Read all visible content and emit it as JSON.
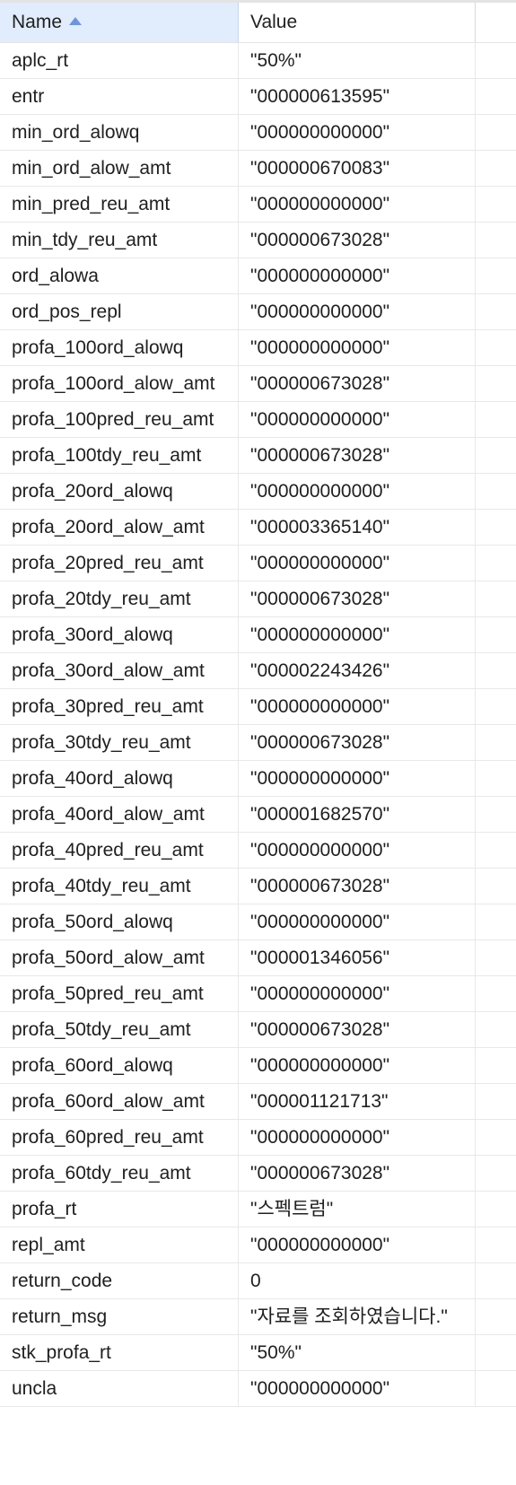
{
  "header": {
    "name_label": "Name",
    "value_label": "Value",
    "sort_icon": "sort-ascending-icon"
  },
  "rows": [
    {
      "name": "aplc_rt",
      "value": "\"50%\""
    },
    {
      "name": "entr",
      "value": "\"000000613595\""
    },
    {
      "name": "min_ord_alowq",
      "value": "\"000000000000\""
    },
    {
      "name": "min_ord_alow_amt",
      "value": "\"000000670083\""
    },
    {
      "name": "min_pred_reu_amt",
      "value": "\"000000000000\""
    },
    {
      "name": "min_tdy_reu_amt",
      "value": "\"000000673028\""
    },
    {
      "name": "ord_alowa",
      "value": "\"000000000000\""
    },
    {
      "name": "ord_pos_repl",
      "value": "\"000000000000\""
    },
    {
      "name": "profa_100ord_alowq",
      "value": "\"000000000000\""
    },
    {
      "name": "profa_100ord_alow_amt",
      "value": "\"000000673028\""
    },
    {
      "name": "profa_100pred_reu_amt",
      "value": "\"000000000000\""
    },
    {
      "name": "profa_100tdy_reu_amt",
      "value": "\"000000673028\""
    },
    {
      "name": "profa_20ord_alowq",
      "value": "\"000000000000\""
    },
    {
      "name": "profa_20ord_alow_amt",
      "value": "\"000003365140\""
    },
    {
      "name": "profa_20pred_reu_amt",
      "value": "\"000000000000\""
    },
    {
      "name": "profa_20tdy_reu_amt",
      "value": "\"000000673028\""
    },
    {
      "name": "profa_30ord_alowq",
      "value": "\"000000000000\""
    },
    {
      "name": "profa_30ord_alow_amt",
      "value": "\"000002243426\""
    },
    {
      "name": "profa_30pred_reu_amt",
      "value": "\"000000000000\""
    },
    {
      "name": "profa_30tdy_reu_amt",
      "value": "\"000000673028\""
    },
    {
      "name": "profa_40ord_alowq",
      "value": "\"000000000000\""
    },
    {
      "name": "profa_40ord_alow_amt",
      "value": "\"000001682570\""
    },
    {
      "name": "profa_40pred_reu_amt",
      "value": "\"000000000000\""
    },
    {
      "name": "profa_40tdy_reu_amt",
      "value": "\"000000673028\""
    },
    {
      "name": "profa_50ord_alowq",
      "value": "\"000000000000\""
    },
    {
      "name": "profa_50ord_alow_amt",
      "value": "\"000001346056\""
    },
    {
      "name": "profa_50pred_reu_amt",
      "value": "\"000000000000\""
    },
    {
      "name": "profa_50tdy_reu_amt",
      "value": "\"000000673028\""
    },
    {
      "name": "profa_60ord_alowq",
      "value": "\"000000000000\""
    },
    {
      "name": "profa_60ord_alow_amt",
      "value": "\"000001121713\""
    },
    {
      "name": "profa_60pred_reu_amt",
      "value": "\"000000000000\""
    },
    {
      "name": "profa_60tdy_reu_amt",
      "value": "\"000000673028\""
    },
    {
      "name": "profa_rt",
      "value": "\"스펙트럼\""
    },
    {
      "name": "repl_amt",
      "value": "\"000000000000\""
    },
    {
      "name": "return_code",
      "value": "0"
    },
    {
      "name": "return_msg",
      "value": "\"자료를 조회하였습니다.\""
    },
    {
      "name": "stk_profa_rt",
      "value": "\"50%\""
    },
    {
      "name": "uncla",
      "value": "\"000000000000\""
    }
  ]
}
